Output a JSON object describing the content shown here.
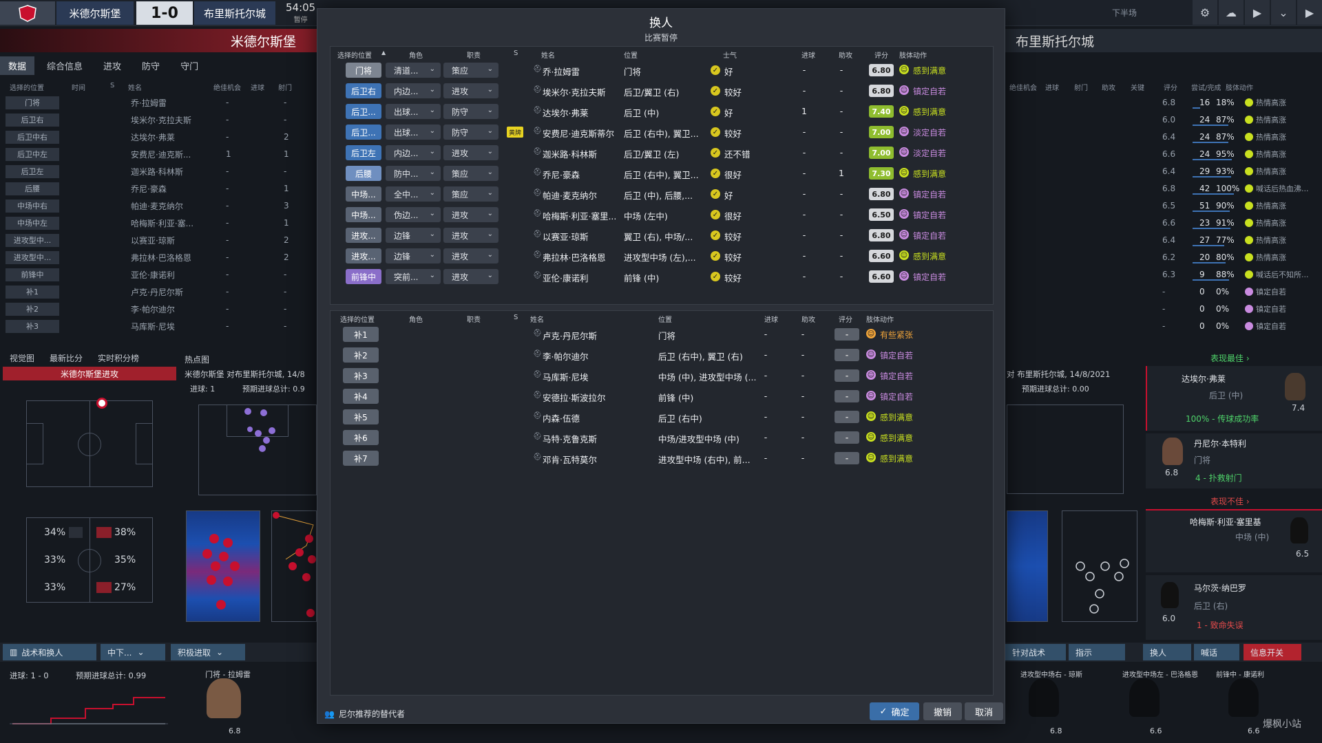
{
  "top": {
    "home": "米德尔斯堡",
    "score": "1-0",
    "away": "布里斯托尔城",
    "clock": "54:05",
    "status": "暂停",
    "half": "下半场"
  },
  "left_panel": {
    "title": "米德尔斯堡",
    "tabs": [
      "数据",
      "综合信息",
      "进攻",
      "防守",
      "守门"
    ],
    "header": [
      "选择的位置",
      "时间",
      "S",
      "姓名",
      "绝佳机会",
      "进球",
      "射门"
    ],
    "rows": [
      {
        "pos": "门将",
        "name": "乔·拉姆雷",
        "c1": "-",
        "c2": "-"
      },
      {
        "pos": "后卫右",
        "name": "埃米尔·克拉夫斯",
        "c1": "-",
        "c2": "-"
      },
      {
        "pos": "后卫中右",
        "name": "达埃尔·弗莱",
        "c1": "-",
        "c2": "2"
      },
      {
        "pos": "后卫中左",
        "name": "安费尼·迪克斯...",
        "c1": "1",
        "c2": "1"
      },
      {
        "pos": "后卫左",
        "name": "迦米路·科林斯",
        "c1": "-",
        "c2": "-"
      },
      {
        "pos": "后腰",
        "name": "乔尼·豪森",
        "c1": "-",
        "c2": "1"
      },
      {
        "pos": "中场中右",
        "name": "帕迪·麦克纳尔",
        "c1": "-",
        "c2": "3"
      },
      {
        "pos": "中场中左",
        "name": "哈梅斯·利亚·塞...",
        "c1": "-",
        "c2": "1"
      },
      {
        "pos": "进攻型中...",
        "name": "以赛亚·琼斯",
        "c1": "-",
        "c2": "2"
      },
      {
        "pos": "进攻型中...",
        "name": "弗拉林·巴洛格恩",
        "c1": "-",
        "c2": "2"
      },
      {
        "pos": "前锋中",
        "name": "亚伦·康诺利",
        "c1": "-",
        "c2": "-"
      },
      {
        "pos": "补1",
        "name": "卢克·丹尼尔斯",
        "c1": "-",
        "c2": "-"
      },
      {
        "pos": "补2",
        "name": "李·帕尔迪尔",
        "c1": "-",
        "c2": "-"
      },
      {
        "pos": "补3",
        "name": "马库斯·尼埃",
        "c1": "-",
        "c2": "-"
      }
    ],
    "sub_tabs": [
      "视觉图",
      "最新比分",
      "实时积分榜"
    ],
    "attack_label": "米德尔斯堡进攻",
    "heatmap_label": "热点图",
    "match_info": "米德尔斯堡 对布里斯托尔城, 14/8",
    "goals_line": "进球: 1",
    "xg_line": "预期进球总计: 0.9",
    "pcts_left": [
      "34%",
      "33%",
      "33%"
    ],
    "pcts_right": [
      "38%",
      "35%",
      "27%"
    ]
  },
  "right_panel": {
    "title": "布里斯托尔城",
    "header": [
      "绝佳机会",
      "进球",
      "射门",
      "助攻",
      "关键",
      "评分",
      "尝试/完成",
      "肢体动作"
    ],
    "rows": [
      {
        "r": "6.8",
        "a": "16",
        "p": "18%",
        "b": "热情高涨"
      },
      {
        "r": "6.0",
        "a": "24",
        "p": "87%",
        "b": "热情高涨"
      },
      {
        "r": "6.4",
        "a": "24",
        "p": "87%",
        "b": "热情高涨"
      },
      {
        "r": "6.6",
        "a": "24",
        "p": "95%",
        "b": "热情高涨"
      },
      {
        "r": "6.4",
        "a": "29",
        "p": "93%",
        "b": "热情高涨"
      },
      {
        "r": "6.8",
        "a": "42",
        "p": "100%",
        "b": "喊话后热血沸..."
      },
      {
        "r": "6.5",
        "a": "51",
        "p": "90%",
        "b": "热情高涨"
      },
      {
        "r": "6.6",
        "a": "23",
        "p": "91%",
        "b": "热情高涨"
      },
      {
        "r": "6.4",
        "a": "27",
        "p": "77%",
        "b": "热情高涨"
      },
      {
        "r": "6.2",
        "a": "20",
        "p": "80%",
        "b": "热情高涨"
      },
      {
        "r": "6.3",
        "a": "9",
        "p": "88%",
        "b": "喊话后不知所..."
      },
      {
        "r": "-",
        "a": "0",
        "p": "0%",
        "b": "镇定自若"
      },
      {
        "r": "-",
        "a": "0",
        "p": "0%",
        "b": "镇定自若"
      },
      {
        "r": "-",
        "a": "0",
        "p": "0%",
        "b": "镇定自若"
      }
    ],
    "best_label": "表现最佳 ›",
    "worst_label": "表现不佳 ›",
    "match_info": "对 布里斯托尔城, 14/8/2021",
    "xg_line": "预期进球总计: 0.00",
    "p1_name": "达埃尔·弗莱",
    "p1_pos": "后卫 (中)",
    "p1_rating": "7.4",
    "p1_stat": "100% - 传球成功率",
    "p2_name": "丹尼尔·本特利",
    "p2_pos": "门将",
    "p2_rating": "6.8",
    "p2_stat": "4 - 扑救射门",
    "p3_name": "哈梅斯·利亚·塞里基",
    "p3_pos": "中场 (中)",
    "p3_rating": "6.5",
    "p4_name": "马尔茨·纳巴罗",
    "p4_pos": "后卫 (右)",
    "p4_rating": "6.0",
    "p4_stat": "1 - 致命失误"
  },
  "bottom": {
    "btn_tactics": "战术和换人",
    "btn_mid": "中下...",
    "btn_attack": "积极进取",
    "btn_vs": "针对战术",
    "btn_instr": "指示",
    "btn_sub": "换人",
    "btn_shout": "喊话",
    "btn_info": "信息开关",
    "goals": "进球: 1 - 0",
    "xg": "预期进球总计: 0.99",
    "gk_label": "门将 - 拉姆雷",
    "gk_rating": "6.8",
    "r_labels": [
      "进攻型中场右 - 琼斯",
      "进攻型中场左 - 巴洛格恩",
      "前锋中 - 康诺利"
    ],
    "r_ratings": [
      "6.8",
      "6.6",
      "6.6"
    ],
    "watermark": "爆枫小站"
  },
  "modal": {
    "title": "换人",
    "subtitle": "比赛暂停",
    "header": [
      "选择的位置",
      "角色",
      "职责",
      "S",
      "姓名",
      "位置",
      "士气",
      "进球",
      "助攻",
      "评分",
      "肢体动作"
    ],
    "starters": [
      {
        "pos": "门将",
        "pt": "gk",
        "role": "清道...",
        "duty": "策应",
        "s": "",
        "name": "乔·拉姆雷",
        "position": "门将",
        "morale": "好",
        "goals": "-",
        "assists": "-",
        "rating": "6.80",
        "rt": "",
        "body": "感到满意",
        "bt": "g"
      },
      {
        "pos": "后卫右",
        "pt": "def",
        "role": "内边...",
        "duty": "进攻",
        "s": "",
        "name": "埃米尔·克拉夫斯",
        "position": "后卫/翼卫 (右)",
        "morale": "较好",
        "goals": "-",
        "assists": "-",
        "rating": "6.80",
        "rt": "",
        "body": "镇定自若",
        "bt": "p"
      },
      {
        "pos": "后卫...",
        "pt": "def",
        "role": "出球...",
        "duty": "防守",
        "s": "",
        "name": "达埃尔·弗莱",
        "position": "后卫 (中)",
        "morale": "好",
        "goals": "1",
        "assists": "-",
        "rating": "7.40",
        "rt": "good",
        "body": "感到满意",
        "bt": "g"
      },
      {
        "pos": "后卫...",
        "pt": "def",
        "role": "出球...",
        "duty": "防守",
        "s": "黄牌",
        "name": "安费尼·迪克斯蒂尔",
        "position": "后卫 (右中), 翼卫...",
        "morale": "较好",
        "goals": "-",
        "assists": "-",
        "rating": "7.00",
        "rt": "good",
        "body": "淡定自若",
        "bt": "p"
      },
      {
        "pos": "后卫左",
        "pt": "def",
        "role": "内边...",
        "duty": "进攻",
        "s": "",
        "name": "迦米路·科林斯",
        "position": "后卫/翼卫 (左)",
        "morale": "还不错",
        "goals": "-",
        "assists": "-",
        "rating": "7.00",
        "rt": "good",
        "body": "淡定自若",
        "bt": "p"
      },
      {
        "pos": "后腰",
        "pt": "dm",
        "role": "防中...",
        "duty": "策应",
        "s": "",
        "name": "乔尼·豪森",
        "position": "后卫 (右中), 翼卫...",
        "morale": "很好",
        "goals": "-",
        "assists": "1",
        "rating": "7.30",
        "rt": "good",
        "body": "感到满意",
        "bt": "g"
      },
      {
        "pos": "中场...",
        "pt": "mid",
        "role": "全中...",
        "duty": "策应",
        "s": "",
        "name": "帕迪·麦克纳尔",
        "position": "后卫 (中), 后腰,...",
        "morale": "好",
        "goals": "-",
        "assists": "-",
        "rating": "6.80",
        "rt": "",
        "body": "镇定自若",
        "bt": "p"
      },
      {
        "pos": "中场...",
        "pt": "mid",
        "role": "伪边...",
        "duty": "进攻",
        "s": "",
        "name": "哈梅斯·利亚·塞里...",
        "position": "中场 (左中)",
        "morale": "很好",
        "goals": "-",
        "assists": "-",
        "rating": "6.50",
        "rt": "",
        "body": "镇定自若",
        "bt": "p"
      },
      {
        "pos": "进攻...",
        "pt": "mid",
        "role": "边锋",
        "duty": "进攻",
        "s": "",
        "name": "以赛亚·琼斯",
        "position": "翼卫 (右), 中场/...",
        "morale": "较好",
        "goals": "-",
        "assists": "-",
        "rating": "6.80",
        "rt": "",
        "body": "镇定自若",
        "bt": "p"
      },
      {
        "pos": "进攻...",
        "pt": "mid",
        "role": "边锋",
        "duty": "进攻",
        "s": "",
        "name": "弗拉林·巴洛格恩",
        "position": "进攻型中场 (左),...",
        "morale": "较好",
        "goals": "-",
        "assists": "-",
        "rating": "6.60",
        "rt": "",
        "body": "感到满意",
        "bt": "g"
      },
      {
        "pos": "前锋中",
        "pt": "fwd",
        "role": "突前...",
        "duty": "进攻",
        "s": "",
        "name": "亚伦·康诺利",
        "position": "前锋 (中)",
        "morale": "较好",
        "goals": "-",
        "assists": "-",
        "rating": "6.60",
        "rt": "",
        "body": "镇定自若",
        "bt": "p"
      }
    ],
    "sub_header": [
      "选择的位置",
      "角色",
      "职责",
      "S",
      "姓名",
      "位置",
      "进球",
      "助攻",
      "评分",
      "肢体动作"
    ],
    "subs": [
      {
        "pos": "补1",
        "name": "卢克·丹尼尔斯",
        "position": "门将",
        "goals": "-",
        "assists": "-",
        "rating": "-",
        "body": "有些紧张",
        "bt": "o"
      },
      {
        "pos": "补2",
        "name": "李·帕尔迪尔",
        "position": "后卫 (右中), 翼卫 (右)",
        "goals": "-",
        "assists": "-",
        "rating": "-",
        "body": "镇定自若",
        "bt": "p"
      },
      {
        "pos": "补3",
        "name": "马库斯·尼埃",
        "position": "中场 (中), 进攻型中场 (...",
        "goals": "-",
        "assists": "-",
        "rating": "-",
        "body": "镇定自若",
        "bt": "p"
      },
      {
        "pos": "补4",
        "name": "安德拉·斯波拉尔",
        "position": "前锋 (中)",
        "goals": "-",
        "assists": "-",
        "rating": "-",
        "body": "镇定自若",
        "bt": "p"
      },
      {
        "pos": "补5",
        "name": "内森·伍德",
        "position": "后卫 (右中)",
        "goals": "-",
        "assists": "-",
        "rating": "-",
        "body": "感到满意",
        "bt": "g"
      },
      {
        "pos": "补6",
        "name": "马特·克鲁克斯",
        "position": "中场/进攻型中场 (中)",
        "goals": "-",
        "assists": "-",
        "rating": "-",
        "body": "感到满意",
        "bt": "g"
      },
      {
        "pos": "补7",
        "name": "邓肯·瓦特莫尔",
        "position": "进攻型中场 (右中), 前...",
        "goals": "-",
        "assists": "-",
        "rating": "-",
        "body": "感到满意",
        "bt": "g"
      }
    ],
    "suggest": "尼尔推荐的替代者",
    "btn_confirm": "确定",
    "btn_undo": "撤销",
    "btn_cancel": "取消"
  },
  "colors": {
    "accent": "#3e73b5",
    "good_rating": "#8fbd2f",
    "body_green": "#c9e020",
    "body_purple": "#c98be0",
    "body_orange": "#f0a43a"
  }
}
